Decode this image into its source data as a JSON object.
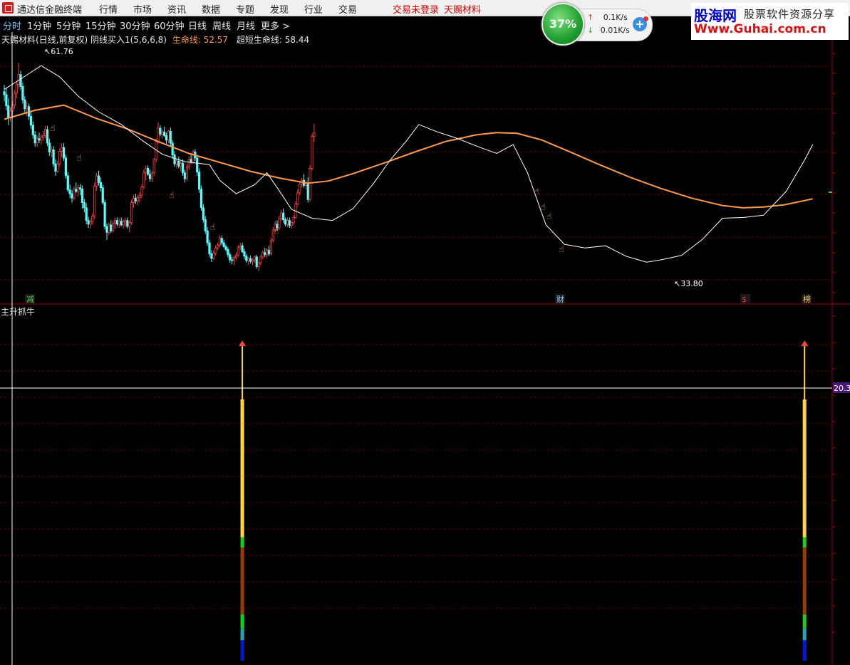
{
  "app": {
    "title": "通达信金融终端",
    "menu": [
      "行情",
      "市场",
      "资讯",
      "数据",
      "专题",
      "发现",
      "行业",
      "交易"
    ],
    "status_login": "交易未登录",
    "stock_name": "天赐材料"
  },
  "tabs": [
    "分时",
    "1分钟",
    "5分钟",
    "15分钟",
    "30分钟",
    "60分钟",
    "日线",
    "周线",
    "月线",
    "更多 >"
  ],
  "active_tab": "分时",
  "info": {
    "prefix": "天赐材料(日线,前复权) 阴线买入1(5,6,6,8)",
    "life_label": "生命线:",
    "life_value": "52.57",
    "ultra_label": "超短生命线:",
    "ultra_value": "58.44"
  },
  "network": {
    "percent": "37%",
    "up": "0.1K/s",
    "down": "0.01K/s",
    "plus": "+"
  },
  "brand": {
    "name": "股海网",
    "slogan": "股票软件资源分享",
    "url": "Www.Guhai.com.cn"
  },
  "colors": {
    "up_candle": "#ff3c3c",
    "down_candle": "#54ffff",
    "ma_long": "#ff9a4a",
    "ma_short": "#ffffff",
    "hand_icon": "#f6c25a",
    "grid": "#7a0000",
    "crosshair": "#ffffff"
  },
  "chart_labels": {
    "high": "61.76",
    "low": "33.80",
    "marker1": "减",
    "marker2": "财",
    "marker3": "$",
    "marker4": "榜",
    "indicator_title": "主升抓牛",
    "indicator_value": "20.3"
  },
  "chart_data": {
    "type": "candlestick",
    "ylim": [
      31,
      64
    ],
    "candles": [
      [
        57.9,
        58.8,
        56.6,
        57.5
      ],
      [
        57.5,
        58.4,
        55.4,
        56.0
      ],
      [
        56.0,
        57.0,
        53.4,
        54.4
      ],
      [
        54.4,
        55.8,
        53.9,
        55.3
      ],
      [
        55.3,
        56.6,
        54.6,
        56.1
      ],
      [
        56.1,
        58.1,
        55.6,
        57.7
      ],
      [
        57.7,
        59.3,
        57.0,
        58.9
      ],
      [
        58.9,
        61.8,
        58.3,
        60.2
      ],
      [
        60.2,
        60.7,
        58.1,
        58.6
      ],
      [
        58.6,
        59.1,
        56.3,
        56.8
      ],
      [
        56.8,
        57.3,
        54.9,
        55.6
      ],
      [
        55.6,
        56.6,
        54.6,
        55.9
      ],
      [
        55.9,
        56.3,
        54.1,
        54.6
      ],
      [
        54.6,
        55.3,
        52.9,
        53.4
      ],
      [
        53.4,
        53.9,
        51.6,
        52.1
      ],
      [
        52.1,
        52.6,
        50.5,
        51.0
      ],
      [
        51.0,
        52.0,
        50.5,
        51.6
      ],
      [
        51.6,
        52.4,
        51.0,
        51.4
      ],
      [
        51.4,
        52.2,
        50.8,
        51.8
      ],
      [
        51.8,
        52.6,
        51.3,
        52.0
      ],
      [
        52.0,
        53.3,
        51.6,
        52.8
      ],
      [
        52.8,
        53.3,
        50.6,
        51.0
      ],
      [
        51.0,
        51.6,
        49.3,
        49.8
      ],
      [
        49.8,
        50.6,
        49.1,
        50.1
      ],
      [
        50.1,
        50.6,
        47.8,
        48.2
      ],
      [
        48.2,
        48.8,
        46.6,
        47.2
      ],
      [
        47.2,
        48.6,
        47.0,
        48.2
      ],
      [
        48.2,
        50.3,
        47.8,
        49.9
      ],
      [
        49.9,
        51.0,
        49.1,
        50.4
      ],
      [
        50.4,
        51.0,
        48.6,
        49.0
      ],
      [
        49.0,
        49.4,
        46.2,
        46.6
      ],
      [
        46.6,
        47.1,
        44.4,
        44.7
      ],
      [
        44.7,
        45.4,
        43.6,
        44.2
      ],
      [
        44.2,
        44.7,
        43.0,
        43.6
      ],
      [
        43.6,
        45.2,
        43.3,
        44.8
      ],
      [
        44.8,
        45.7,
        44.3,
        44.5
      ],
      [
        44.5,
        45.4,
        43.8,
        45.0
      ],
      [
        45.0,
        45.5,
        44.0,
        44.8
      ],
      [
        44.8,
        45.3,
        42.2,
        43.0
      ],
      [
        43.0,
        43.5,
        41.7,
        42.3
      ],
      [
        42.3,
        42.9,
        40.1,
        40.6
      ],
      [
        40.6,
        41.1,
        39.6,
        40.1
      ],
      [
        40.1,
        40.8,
        39.5,
        40.4
      ],
      [
        40.4,
        41.6,
        40.0,
        41.2
      ],
      [
        41.2,
        45.7,
        40.8,
        45.2
      ],
      [
        45.2,
        47.0,
        44.6,
        46.6
      ],
      [
        46.6,
        47.3,
        45.3,
        45.7
      ],
      [
        45.7,
        46.4,
        44.5,
        45.0
      ],
      [
        45.0,
        45.4,
        42.7,
        43.0
      ],
      [
        43.0,
        43.4,
        39.4,
        39.8
      ],
      [
        39.8,
        40.2,
        38.0,
        39.0
      ],
      [
        39.0,
        40.3,
        38.6,
        40.0
      ],
      [
        40.0,
        40.6,
        38.9,
        39.2
      ],
      [
        39.2,
        40.6,
        39.0,
        40.2
      ],
      [
        40.2,
        41.0,
        39.5,
        40.6
      ],
      [
        40.6,
        41.0,
        39.8,
        40.1
      ],
      [
        40.1,
        40.9,
        39.6,
        40.5
      ],
      [
        40.5,
        41.0,
        39.8,
        40.0
      ],
      [
        40.0,
        40.8,
        39.5,
        40.4
      ],
      [
        40.4,
        41.0,
        39.7,
        40.6
      ],
      [
        40.6,
        41.0,
        39.5,
        39.8
      ],
      [
        39.8,
        40.6,
        39.0,
        40.3
      ],
      [
        40.3,
        43.4,
        40.0,
        43.0
      ],
      [
        43.0,
        44.0,
        42.3,
        43.6
      ],
      [
        43.6,
        44.2,
        42.8,
        43.2
      ],
      [
        43.2,
        44.0,
        42.6,
        43.7
      ],
      [
        43.7,
        44.4,
        43.0,
        44.0
      ],
      [
        44.0,
        45.4,
        43.6,
        45.1
      ],
      [
        45.1,
        47.4,
        44.8,
        47.0
      ],
      [
        47.0,
        48.0,
        46.0,
        47.6
      ],
      [
        47.6,
        48.0,
        46.6,
        46.8
      ],
      [
        46.8,
        47.4,
        45.8,
        46.2
      ],
      [
        46.2,
        47.2,
        45.7,
        47.0
      ],
      [
        47.0,
        49.0,
        46.6,
        48.8
      ],
      [
        48.8,
        51.6,
        48.4,
        51.2
      ],
      [
        51.2,
        53.8,
        50.9,
        53.0
      ],
      [
        53.0,
        53.4,
        51.9,
        52.2
      ],
      [
        52.2,
        52.8,
        51.6,
        52.5
      ],
      [
        52.5,
        53.2,
        51.8,
        52.0
      ],
      [
        52.0,
        52.4,
        50.9,
        51.4
      ],
      [
        51.4,
        52.8,
        51.0,
        52.6
      ],
      [
        52.6,
        53.1,
        50.6,
        51.0
      ],
      [
        51.0,
        51.4,
        48.9,
        49.4
      ],
      [
        49.4,
        49.9,
        47.8,
        48.2
      ],
      [
        48.2,
        48.9,
        47.6,
        48.6
      ],
      [
        48.6,
        49.2,
        47.6,
        47.9
      ],
      [
        47.9,
        48.6,
        47.2,
        48.3
      ],
      [
        48.3,
        48.8,
        46.6,
        47.0
      ],
      [
        47.0,
        47.4,
        45.7,
        46.2
      ],
      [
        46.2,
        48.2,
        45.9,
        47.8
      ],
      [
        47.8,
        49.2,
        47.4,
        48.8
      ],
      [
        48.8,
        49.4,
        48.2,
        48.4
      ],
      [
        48.4,
        50.1,
        48.2,
        49.8
      ],
      [
        49.8,
        50.2,
        48.6,
        49.0
      ],
      [
        49.0,
        49.4,
        46.6,
        47.1
      ],
      [
        47.1,
        47.6,
        44.3,
        44.8
      ],
      [
        44.8,
        45.3,
        41.9,
        42.3
      ],
      [
        42.3,
        42.8,
        40.3,
        40.7
      ],
      [
        40.7,
        41.2,
        38.8,
        39.2
      ],
      [
        39.2,
        39.7,
        37.2,
        37.6
      ],
      [
        37.6,
        38.0,
        35.7,
        36.1
      ],
      [
        36.1,
        36.6,
        35.0,
        35.5
      ],
      [
        35.5,
        36.6,
        35.3,
        36.2
      ],
      [
        36.2,
        37.2,
        35.9,
        36.9
      ],
      [
        36.9,
        37.6,
        36.6,
        37.3
      ],
      [
        37.3,
        38.6,
        37.0,
        38.2
      ],
      [
        38.2,
        38.6,
        37.3,
        37.6
      ],
      [
        37.6,
        38.0,
        36.9,
        37.1
      ],
      [
        37.1,
        37.4,
        36.4,
        36.7
      ],
      [
        36.7,
        37.0,
        35.6,
        36.0
      ],
      [
        36.0,
        36.3,
        34.9,
        35.3
      ],
      [
        35.3,
        35.7,
        34.7,
        35.2
      ],
      [
        35.2,
        35.9,
        34.6,
        35.6
      ],
      [
        35.6,
        36.3,
        35.3,
        35.9
      ],
      [
        35.9,
        37.3,
        35.7,
        37.0
      ],
      [
        37.0,
        37.6,
        36.6,
        37.2
      ],
      [
        37.2,
        37.6,
        36.2,
        36.4
      ],
      [
        36.4,
        36.8,
        35.4,
        35.8
      ],
      [
        35.8,
        36.1,
        34.9,
        35.2
      ],
      [
        35.2,
        35.7,
        34.6,
        35.5
      ],
      [
        35.5,
        35.9,
        34.8,
        35.1
      ],
      [
        35.1,
        35.5,
        34.6,
        35.3
      ],
      [
        35.3,
        35.9,
        34.9,
        35.7
      ],
      [
        35.7,
        36.0,
        34.1,
        34.4
      ],
      [
        34.4,
        35.1,
        33.8,
        34.9
      ],
      [
        34.9,
        36.0,
        34.6,
        35.7
      ],
      [
        35.7,
        36.6,
        35.4,
        36.3
      ],
      [
        36.3,
        36.9,
        35.7,
        36.0
      ],
      [
        36.0,
        36.9,
        35.6,
        36.6
      ],
      [
        36.6,
        37.2,
        35.8,
        36.1
      ],
      [
        36.1,
        38.2,
        35.9,
        37.9
      ],
      [
        37.9,
        39.7,
        37.6,
        39.3
      ],
      [
        39.3,
        40.5,
        39.0,
        40.1
      ],
      [
        40.1,
        40.6,
        39.2,
        39.6
      ],
      [
        39.6,
        41.2,
        39.3,
        40.9
      ],
      [
        40.9,
        42.0,
        40.5,
        41.6
      ],
      [
        41.6,
        42.2,
        40.3,
        40.7
      ],
      [
        40.7,
        41.0,
        39.8,
        40.1
      ],
      [
        40.1,
        41.0,
        39.7,
        40.6
      ],
      [
        40.6,
        41.0,
        39.6,
        39.9
      ],
      [
        39.9,
        40.5,
        39.5,
        40.3
      ],
      [
        40.3,
        41.3,
        40.0,
        41.0
      ],
      [
        41.0,
        43.2,
        40.8,
        42.8
      ],
      [
        42.8,
        44.7,
        42.5,
        44.3
      ],
      [
        44.3,
        45.9,
        44.0,
        45.5
      ],
      [
        45.5,
        46.3,
        45.0,
        46.0
      ],
      [
        46.0,
        46.8,
        45.0,
        45.3
      ],
      [
        45.3,
        46.0,
        44.8,
        45.6
      ],
      [
        45.6,
        46.4,
        43.0,
        43.4
      ],
      [
        43.4,
        48.0,
        43.1,
        47.6
      ],
      [
        47.6,
        52.3,
        47.3,
        51.9
      ],
      [
        51.9,
        53.6,
        51.2,
        52.4
      ]
    ],
    "ma_long": [
      [
        0,
        54.2
      ],
      [
        15,
        55.4
      ],
      [
        29,
        56.1
      ],
      [
        45,
        54.3
      ],
      [
        60,
        52.9
      ],
      [
        75,
        51.2
      ],
      [
        90,
        49.6
      ],
      [
        105,
        48.4
      ],
      [
        120,
        47.2
      ],
      [
        134,
        46.3
      ],
      [
        148,
        45.6
      ],
      [
        158,
        45.9
      ],
      [
        170,
        46.9
      ],
      [
        185,
        48.3
      ],
      [
        200,
        49.8
      ],
      [
        215,
        51.2
      ],
      [
        230,
        52.1
      ],
      [
        240,
        52.4
      ],
      [
        250,
        52.3
      ],
      [
        262,
        51.4
      ],
      [
        275,
        49.9
      ],
      [
        290,
        48.1
      ],
      [
        305,
        46.4
      ],
      [
        320,
        44.9
      ],
      [
        335,
        43.6
      ],
      [
        350,
        42.6
      ],
      [
        360,
        42.3
      ],
      [
        370,
        42.4
      ],
      [
        380,
        42.7
      ],
      [
        394,
        43.5
      ]
    ],
    "ma_short": [
      [
        0,
        58.2
      ],
      [
        8,
        59.6
      ],
      [
        18,
        61.4
      ],
      [
        27,
        59.9
      ],
      [
        36,
        57.3
      ],
      [
        46,
        55.2
      ],
      [
        57,
        53.5
      ],
      [
        68,
        51.2
      ],
      [
        77,
        49.5
      ],
      [
        88,
        48.5
      ],
      [
        100,
        48.1
      ],
      [
        105,
        46.0
      ],
      [
        113,
        44.2
      ],
      [
        122,
        45.4
      ],
      [
        128,
        47.0
      ],
      [
        134,
        44.6
      ],
      [
        140,
        42.1
      ],
      [
        150,
        40.9
      ],
      [
        160,
        40.6
      ],
      [
        170,
        42.2
      ],
      [
        180,
        45.6
      ],
      [
        188,
        48.7
      ],
      [
        196,
        51.3
      ],
      [
        202,
        53.5
      ],
      [
        211,
        52.5
      ],
      [
        220,
        51.7
      ],
      [
        232,
        50.4
      ],
      [
        240,
        49.6
      ],
      [
        248,
        50.8
      ],
      [
        255,
        47.0
      ],
      [
        264,
        40.0
      ],
      [
        273,
        37.4
      ],
      [
        283,
        36.9
      ],
      [
        293,
        37.2
      ],
      [
        303,
        35.8
      ],
      [
        313,
        35.0
      ],
      [
        320,
        35.3
      ],
      [
        330,
        35.9
      ],
      [
        340,
        38.0
      ],
      [
        350,
        40.9
      ],
      [
        360,
        41.0
      ],
      [
        370,
        41.3
      ],
      [
        381,
        44.5
      ],
      [
        390,
        48.7
      ],
      [
        394,
        50.8
      ]
    ],
    "hand_icons": [
      [
        24,
        53.4
      ],
      [
        37,
        49.4
      ],
      [
        82,
        44.4
      ],
      [
        102,
        40.1
      ],
      [
        133,
        39.6
      ],
      [
        260,
        44.9
      ],
      [
        263,
        42.8
      ],
      [
        266,
        41.5
      ],
      [
        272,
        37.1
      ]
    ],
    "indicator": {
      "ylim": [
        0,
        26
      ],
      "signals": [
        116,
        390
      ],
      "level_line": 20.3
    }
  }
}
